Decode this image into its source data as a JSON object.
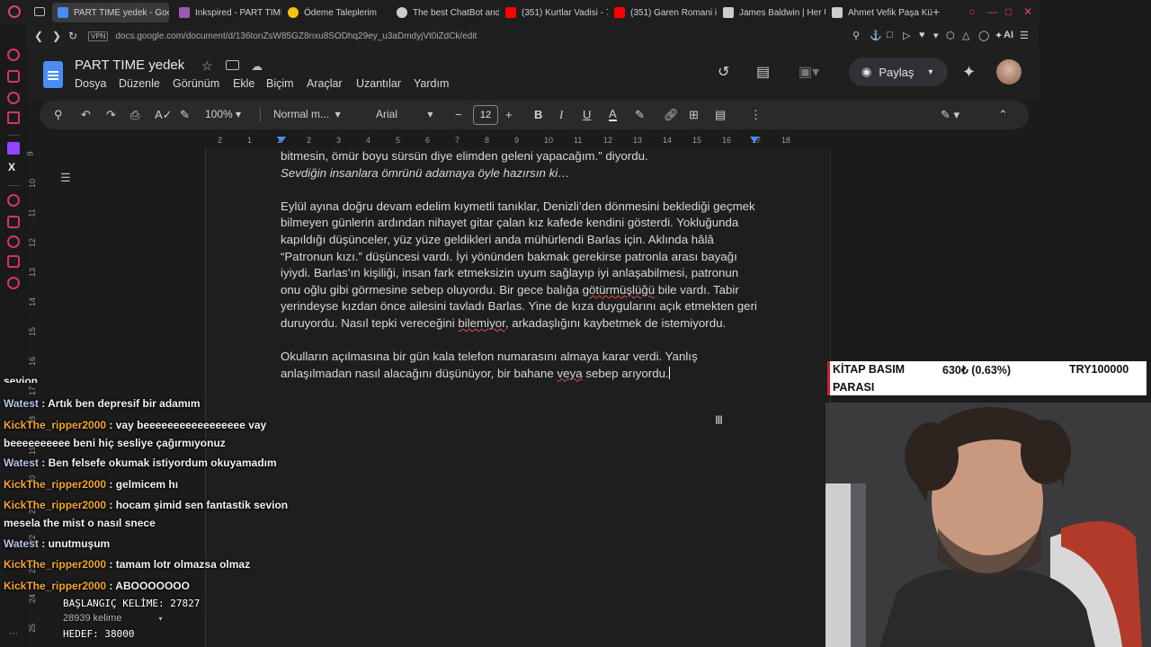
{
  "tabs": [
    {
      "title": "PART TIME yedek - Google",
      "active": true,
      "color": "#4a8cf4"
    },
    {
      "title": "Inkspired - PART TIME",
      "active": false,
      "color": "#9b59b6"
    },
    {
      "title": "Ödeme Taleplerim",
      "active": false,
      "color": "#f1c40f"
    },
    {
      "title": "The best ChatBot and",
      "active": false,
      "color": "#cccccc"
    },
    {
      "title": "(351) Kurtlar Vadisi - 7",
      "active": false,
      "color": "#ff0000"
    },
    {
      "title": "(351) Garen Romani in",
      "active": false,
      "color": "#ff0000"
    },
    {
      "title": "James Baldwin | Her U",
      "active": false,
      "color": "#cccccc"
    },
    {
      "title": "Ahmet Vefik Paşa Kütü",
      "active": false,
      "color": "#cccccc"
    }
  ],
  "address": {
    "vpn": "VPN",
    "url": "docs.google.com/document/d/136tonZsW85GZ8nxu8SODhq29ey_u3aDmdyjVt0iZdCk/edit",
    "ai_label": "AI"
  },
  "docs": {
    "title": "PART TIME yedek",
    "menu": [
      "Dosya",
      "Düzenle",
      "Görünüm",
      "Ekle",
      "Biçim",
      "Araçlar",
      "Uzantılar",
      "Yardım"
    ],
    "share_label": "Paylaş"
  },
  "toolbar": {
    "zoom": "100%",
    "style": "Normal m...",
    "font": "Arial",
    "font_size": "12"
  },
  "ruler": {
    "ticks": [
      "2",
      "1",
      "1",
      "2",
      "3",
      "4",
      "5",
      "6",
      "7",
      "8",
      "9",
      "10",
      "11",
      "12",
      "13",
      "14",
      "15",
      "16",
      "17",
      "18"
    ],
    "vticks": [
      "9",
      "10",
      "11",
      "12",
      "13",
      "14",
      "15",
      "16",
      "17",
      "18",
      "19",
      "20",
      "21",
      "22",
      "23",
      "24",
      "25"
    ]
  },
  "document": {
    "p1_line1": "bitmesin, ömür boyu sürsün diye elimden geleni yapacağım.” diyordu.",
    "p1_line2": "Sevdiğin insanlara ömrünü adamaya öyle hazırsın ki…",
    "p2_a": "Eylül ayına doğru devam edelim kıymetli tanıklar, Denizli’den dönmesini beklediği geçmek bilmeyen günlerin ardından nihayet gitar çalan kız kafede kendini gösterdi. Yokluğunda kapıldığı düşünceler, yüz yüze geldikleri anda mühürlendi Barlas için. Aklında hâlâ “Patronun kızı.” düşüncesi vardı. İyi yönünden bakmak gerekirse patronla arası bayağı iyiydi. Barlas’ın kişiliği, insan fark etmeksizin uyum sağlayıp iyi anlaşabilmesi, patronun onu oğlu gibi görmesine sebep oluyordu. Bir gece balığa ",
    "p2_sq1": "götürmüşlüğü",
    "p2_b": " bile vardı. Tabir yerindeyse kızdan önce ailesini tavladı Barlas. Yine de kıza duygularını açık etmekten geri duruyordu. Nasıl tepki vereceğini ",
    "p2_sq2": "bilemiyor",
    "p2_c": ", arkadaşlığını kaybetmek de istemiyordu.",
    "p3_a": "Okulların açılmasına bir gün kala telefon numarasını almaya karar verdi. Yanlış anlaşılmadan nasıl alacağını düşünüyor, bir bahane ",
    "p3_sq": "veya",
    "p3_b": " sebep arıyordu."
  },
  "chat": {
    "cut_top": "sevion",
    "messages": [
      {
        "user": "Watest",
        "text": " : Artık ben depresif bir adamım"
      },
      {
        "user": "KickThe_ripper2000",
        "text": " : vay beeeeeeeeeeeeeeeee vay beeeeeeeeee beni hiç sesliye çağırmıyonuz"
      },
      {
        "user": "Watest",
        "text": " : Ben felsefe okumak istiyordum okuyamadım"
      },
      {
        "user": "KickThe_ripper2000",
        "text": " : gelmicem hı"
      },
      {
        "user": "KickThe_ripper2000",
        "text": " : hocam şimid sen fantastik sevion mesela the mist o nasıl snece"
      },
      {
        "user": "Watest",
        "text": " : unutmuşum"
      },
      {
        "user": "KickThe_ripper2000",
        "text": " : tamam lotr olmazsa olmaz"
      },
      {
        "user": "KickThe_ripper2000",
        "text": " : ABOOOOOOO"
      }
    ]
  },
  "word_counter": {
    "start": "BAŞLANGIÇ KELİME: 27827",
    "current": "28939 kelime",
    "target": "HEDEF: 38000"
  },
  "donation": {
    "title_line1": "KİTAP BASIM",
    "title_line2": "PARASI",
    "amount": "630₺ (0.63%)",
    "goal": "TRY100000"
  },
  "colors": {
    "accent": "#4a8cf4",
    "opera": "#d6336c",
    "kick_user": "#f5a623",
    "watest_user": "#b8c4e8"
  }
}
